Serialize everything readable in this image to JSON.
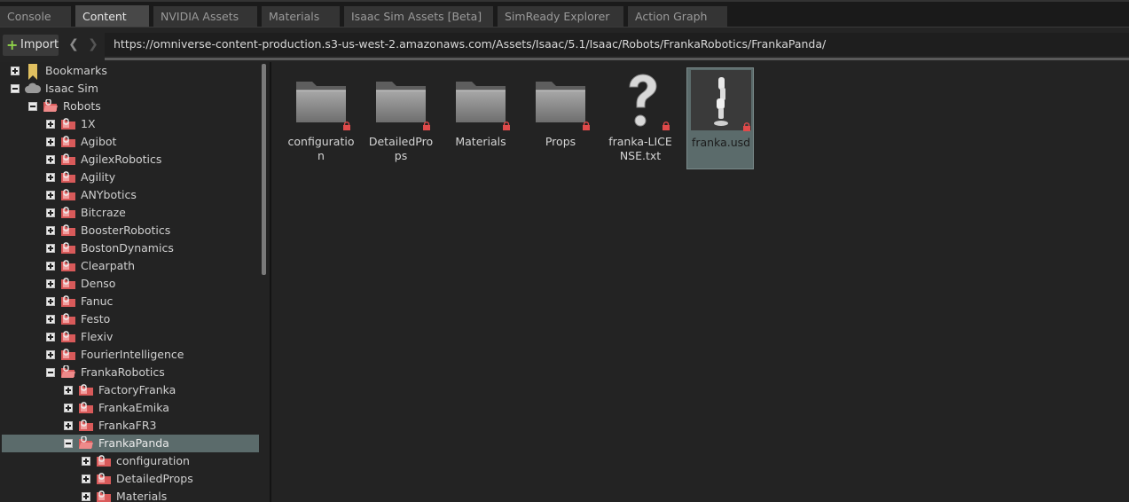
{
  "tabs": [
    {
      "label": "Console"
    },
    {
      "label": "Content"
    },
    {
      "label": "NVIDIA Assets"
    },
    {
      "label": "Materials"
    },
    {
      "label": "Isaac Sim Assets [Beta]"
    },
    {
      "label": "SimReady Explorer"
    },
    {
      "label": "Action Graph"
    }
  ],
  "toolbar": {
    "import_label": "Import",
    "url": "https://omniverse-content-production.s3-us-west-2.amazonaws.com/Assets/Isaac/5.1/Isaac/Robots/FrankaRobotics/FrankaPanda/"
  },
  "tree": [
    {
      "label": "Bookmarks",
      "icon": "bookmark-icon",
      "expanded": false
    },
    {
      "label": "Isaac Sim",
      "icon": "cloud-icon",
      "expanded": true
    },
    {
      "label": "Robots",
      "icon": "folder-open-locked-icon",
      "expanded": true
    },
    {
      "label": "1X",
      "icon": "folder-locked-icon",
      "expanded": false
    },
    {
      "label": "Agibot",
      "icon": "folder-locked-icon",
      "expanded": false
    },
    {
      "label": "AgilexRobotics",
      "icon": "folder-locked-icon",
      "expanded": false
    },
    {
      "label": "Agility",
      "icon": "folder-locked-icon",
      "expanded": false
    },
    {
      "label": "ANYbotics",
      "icon": "folder-locked-icon",
      "expanded": false
    },
    {
      "label": "Bitcraze",
      "icon": "folder-locked-icon",
      "expanded": false
    },
    {
      "label": "BoosterRobotics",
      "icon": "folder-locked-icon",
      "expanded": false
    },
    {
      "label": "BostonDynamics",
      "icon": "folder-locked-icon",
      "expanded": false
    },
    {
      "label": "Clearpath",
      "icon": "folder-locked-icon",
      "expanded": false
    },
    {
      "label": "Denso",
      "icon": "folder-locked-icon",
      "expanded": false
    },
    {
      "label": "Fanuc",
      "icon": "folder-locked-icon",
      "expanded": false
    },
    {
      "label": "Festo",
      "icon": "folder-locked-icon",
      "expanded": false
    },
    {
      "label": "Flexiv",
      "icon": "folder-locked-icon",
      "expanded": false
    },
    {
      "label": "FourierIntelligence",
      "icon": "folder-locked-icon",
      "expanded": false
    },
    {
      "label": "FrankaRobotics",
      "icon": "folder-open-locked-icon",
      "expanded": true
    },
    {
      "label": "FactoryFranka",
      "icon": "folder-locked-icon",
      "expanded": false
    },
    {
      "label": "FrankaEmika",
      "icon": "folder-locked-icon",
      "expanded": false
    },
    {
      "label": "FrankaFR3",
      "icon": "folder-locked-icon",
      "expanded": false
    },
    {
      "label": "FrankaPanda",
      "icon": "folder-open-locked-icon",
      "expanded": true,
      "selected": true
    },
    {
      "label": "configuration",
      "icon": "folder-locked-icon",
      "expanded": false
    },
    {
      "label": "DetailedProps",
      "icon": "folder-locked-icon",
      "expanded": false
    },
    {
      "label": "Materials",
      "icon": "folder-locked-icon",
      "expanded": false
    }
  ],
  "items": [
    {
      "label": "configuration",
      "icon": "folder-icon"
    },
    {
      "label": "DetailedProps",
      "icon": "folder-icon"
    },
    {
      "label": "Materials",
      "icon": "folder-icon"
    },
    {
      "label": "Props",
      "icon": "folder-icon"
    },
    {
      "label": "franka-LICENSE.txt",
      "icon": "unknown-file-icon"
    },
    {
      "label": "franka.usd",
      "icon": "robot-thumbnail",
      "selected": true
    }
  ],
  "colors": {
    "background": "#232323",
    "selection": "#5b6b6b",
    "lock": "#e04a4a",
    "folder_tree": "#d85a5a",
    "bookmark": "#e0c060",
    "import_plus": "#8fd34a"
  }
}
